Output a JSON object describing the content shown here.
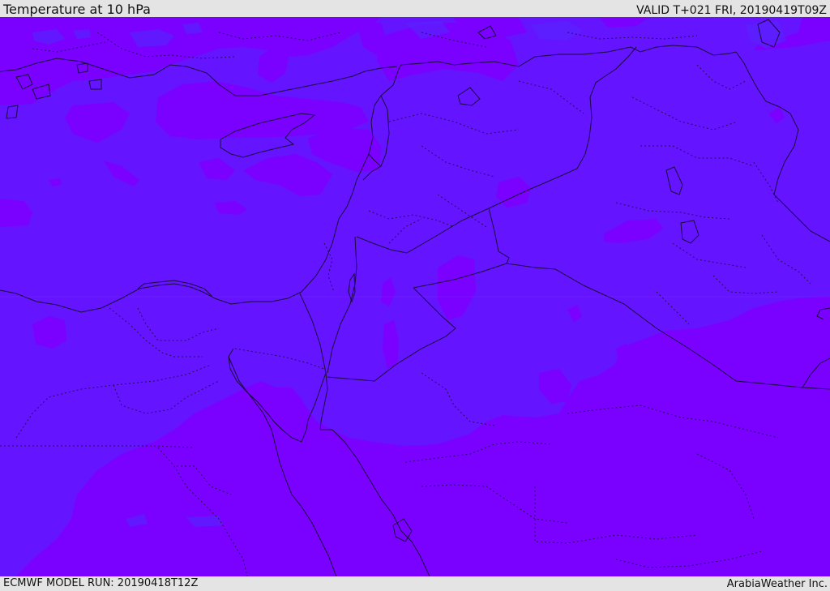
{
  "header": {
    "title": "Temperature at 10 hPa",
    "valid_time": "VALID T+021 FRI, 20190419T09Z"
  },
  "footer": {
    "model_run": "ECMWF MODEL RUN: 20190418T12Z",
    "credit": "ArabiaWeather Inc."
  },
  "map": {
    "field": "temperature",
    "level": "10 hPa",
    "colors": {
      "base": "#6514ff",
      "warm": "#7a00ff",
      "boundary": "#1a0a3a"
    }
  }
}
